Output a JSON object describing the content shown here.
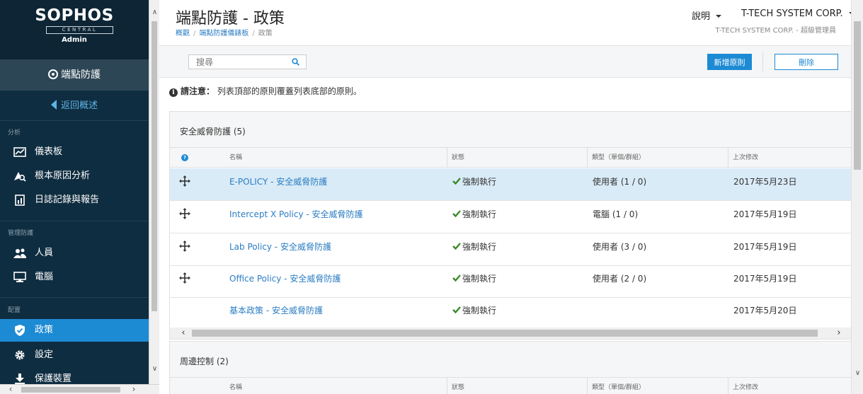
{
  "brand": {
    "name": "SOPHOS",
    "sub": "CENTRAL",
    "role": "Admin"
  },
  "sidebar": {
    "product": "端點防護",
    "back": "返回概述",
    "sections": {
      "analysis": "分析",
      "manage": "管理防護",
      "config": "配置"
    },
    "items": [
      {
        "label": "儀表板",
        "icon": "dashboard-icon"
      },
      {
        "label": "根本原因分析",
        "icon": "root-cause-icon"
      },
      {
        "label": "日誌記錄與報告",
        "icon": "report-icon"
      },
      {
        "label": "人員",
        "icon": "people-icon"
      },
      {
        "label": "電腦",
        "icon": "computer-icon"
      },
      {
        "label": "政策",
        "icon": "shield-icon",
        "active": true
      },
      {
        "label": "設定",
        "icon": "gear-icon"
      },
      {
        "label": "保護裝置",
        "icon": "download-icon"
      }
    ]
  },
  "header": {
    "title": "端點防護 - 政策",
    "breadcrumb": [
      "概觀",
      "端點防護儀錶板",
      "政策"
    ],
    "help": "說明",
    "org": "T-TECH SYSTEM CORP.",
    "role_line": "T-TECH SYSTEM CORP. - 超級管理員"
  },
  "toolbar": {
    "search_placeholder": "搜尋",
    "add_label": "新增原則",
    "delete_label": "刪除"
  },
  "notice": {
    "label": "請注意：",
    "text": "列表頂部的原則覆蓋列表底部的原則。"
  },
  "columns": {
    "name": "名稱",
    "status": "狀態",
    "assign": "類型（單個/群組）",
    "modified": "上次修改"
  },
  "threat_panel": {
    "title": "安全威脅防護 (5)",
    "rows": [
      {
        "name": "E-POLICY - 安全威脅防護",
        "status": "強制執行",
        "assign": "使用者 (1 / 0)",
        "modified": "2017年5月23日",
        "selected": true,
        "draggable": true
      },
      {
        "name": "Intercept X Policy - 安全威脅防護",
        "status": "強制執行",
        "assign": "電腦 (1 / 0)",
        "modified": "2017年5月19日",
        "draggable": true
      },
      {
        "name": "Lab Policy - 安全威脅防護",
        "status": "強制執行",
        "assign": "使用者 (3 / 0)",
        "modified": "2017年5月19日",
        "draggable": true
      },
      {
        "name": "Office Policy - 安全威脅防護",
        "status": "強制執行",
        "assign": "使用者 (2 / 0)",
        "modified": "2017年5月19日",
        "draggable": true
      },
      {
        "name": "基本政策 - 安全威脅防護",
        "status": "強制執行",
        "assign": "",
        "modified": "2017年5月20日",
        "draggable": false
      }
    ]
  },
  "peripheral_panel": {
    "title": "周邊控制 (2)"
  },
  "colors": {
    "sidebar": "#0f2d40",
    "accent": "#1d8ad4",
    "link": "#2b7dc2",
    "check": "#3a8a2a",
    "selected_row": "#d9ebf7"
  }
}
